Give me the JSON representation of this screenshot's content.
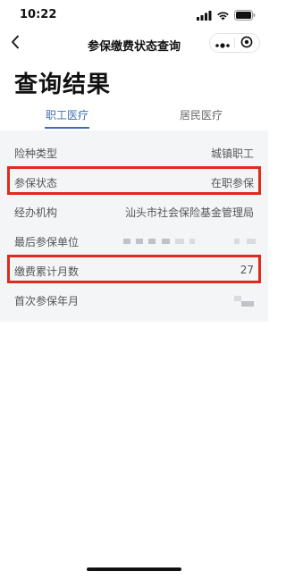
{
  "status_bar": {
    "time": "10:22"
  },
  "nav": {
    "title": "参保缴费状态查询"
  },
  "page": {
    "heading": "查询结果"
  },
  "tabs": [
    {
      "label": "职工医疗",
      "active": true
    },
    {
      "label": "居民医疗",
      "active": false
    }
  ],
  "details": [
    {
      "label": "险种类型",
      "value": "城镇职工"
    },
    {
      "label": "参保状态",
      "value": "在职参保"
    },
    {
      "label": "经办机构",
      "value": "汕头市社会保险基金管理局"
    },
    {
      "label": "最后参保单位",
      "value": ""
    },
    {
      "label": "缴费累计月数",
      "value": "27"
    },
    {
      "label": "首次参保年月",
      "value": ""
    }
  ],
  "colors": {
    "accent": "#3d6fb4",
    "highlight": "#e02a1b",
    "content_bg": "#f4f5f7"
  },
  "icons": {
    "back": "chevron-left-icon",
    "more": "more-dots-icon",
    "close_miniprogram": "target-circle-icon"
  }
}
